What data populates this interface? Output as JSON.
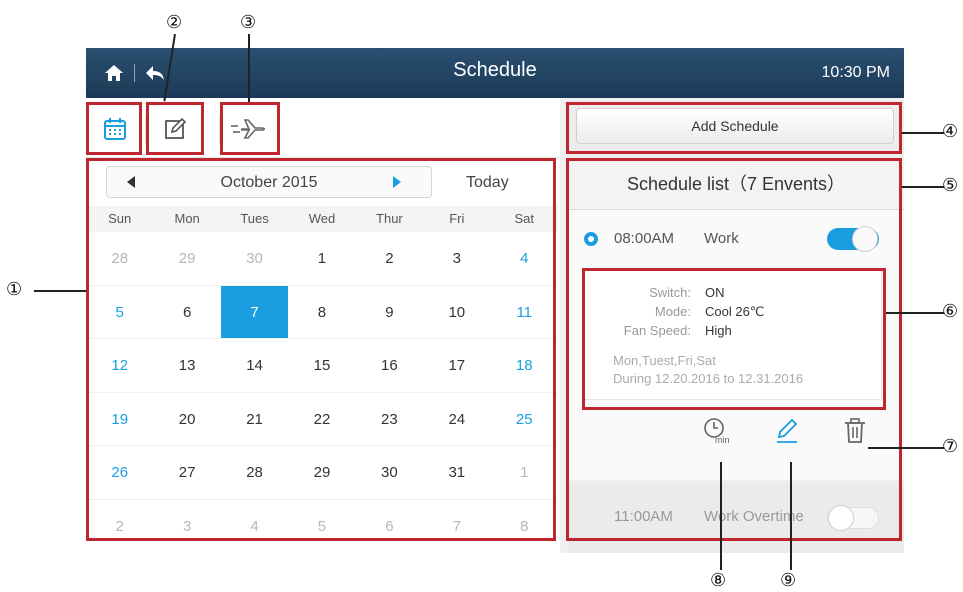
{
  "header": {
    "title": "Schedule",
    "time": "10:30 PM"
  },
  "calendar": {
    "month_label": "October 2015",
    "today_label": "Today",
    "weekdays": [
      "Sun",
      "Mon",
      "Tues",
      "Wed",
      "Thur",
      "Fri",
      "Sat"
    ],
    "weeks": [
      [
        "28",
        "29",
        "30",
        "1",
        "2",
        "3",
        "4"
      ],
      [
        "5",
        "6",
        "7",
        "8",
        "9",
        "10",
        "11"
      ],
      [
        "12",
        "13",
        "14",
        "15",
        "16",
        "17",
        "18"
      ],
      [
        "19",
        "20",
        "21",
        "22",
        "23",
        "24",
        "25"
      ],
      [
        "26",
        "27",
        "28",
        "29",
        "30",
        "31",
        "1"
      ],
      [
        "2",
        "3",
        "4",
        "5",
        "6",
        "7",
        "8"
      ]
    ],
    "selected_day": "7"
  },
  "schedule": {
    "add_label": "Add Schedule",
    "list_title": "Schedule list（7 Envents）",
    "item1": {
      "time": "08:00AM",
      "name": "Work",
      "enabled": true
    },
    "details": {
      "switch_label": "Switch:",
      "switch_value": "ON",
      "mode_label": "Mode:",
      "mode_value": "Cool 26℃",
      "fan_label": "Fan Speed:",
      "fan_value": "High",
      "days": "Mon,Tuest,Fri,Sat",
      "during": "During 12.20.2016 to 12.31.2016"
    },
    "timer_icon_text": "min",
    "item2": {
      "time": "11:00AM",
      "name": "Work Overtime",
      "enabled": false
    }
  },
  "callouts": [
    "①",
    "②",
    "③",
    "④",
    "⑤",
    "⑥",
    "⑦",
    "⑧",
    "⑨"
  ],
  "colors": {
    "header": "#1c3a57",
    "accent": "#1a9ee0",
    "annotation": "#c0262d"
  }
}
